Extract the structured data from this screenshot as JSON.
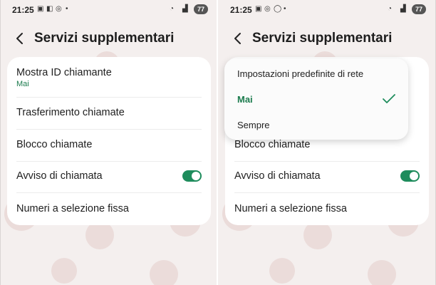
{
  "status": {
    "time": "21:25",
    "battery": "77"
  },
  "header": {
    "title": "Servizi supplementari"
  },
  "settings": {
    "caller_id": {
      "label": "Mostra ID chiamante",
      "value": "Mai"
    },
    "call_forwarding": {
      "label": "Trasferimento chiamate"
    },
    "call_barring": {
      "label": "Blocco chiamate"
    },
    "call_waiting": {
      "label": "Avviso di chiamata",
      "enabled": true
    },
    "fixed_dialing": {
      "label": "Numeri a selezione fissa"
    }
  },
  "dropdown": {
    "options": [
      {
        "label": "Impostazioni predefinite di rete",
        "selected": false
      },
      {
        "label": "Mai",
        "selected": true
      },
      {
        "label": "Sempre",
        "selected": false
      }
    ]
  },
  "colors": {
    "accent": "#1e8c5c",
    "background": "#f4efee",
    "card": "#ffffff"
  }
}
